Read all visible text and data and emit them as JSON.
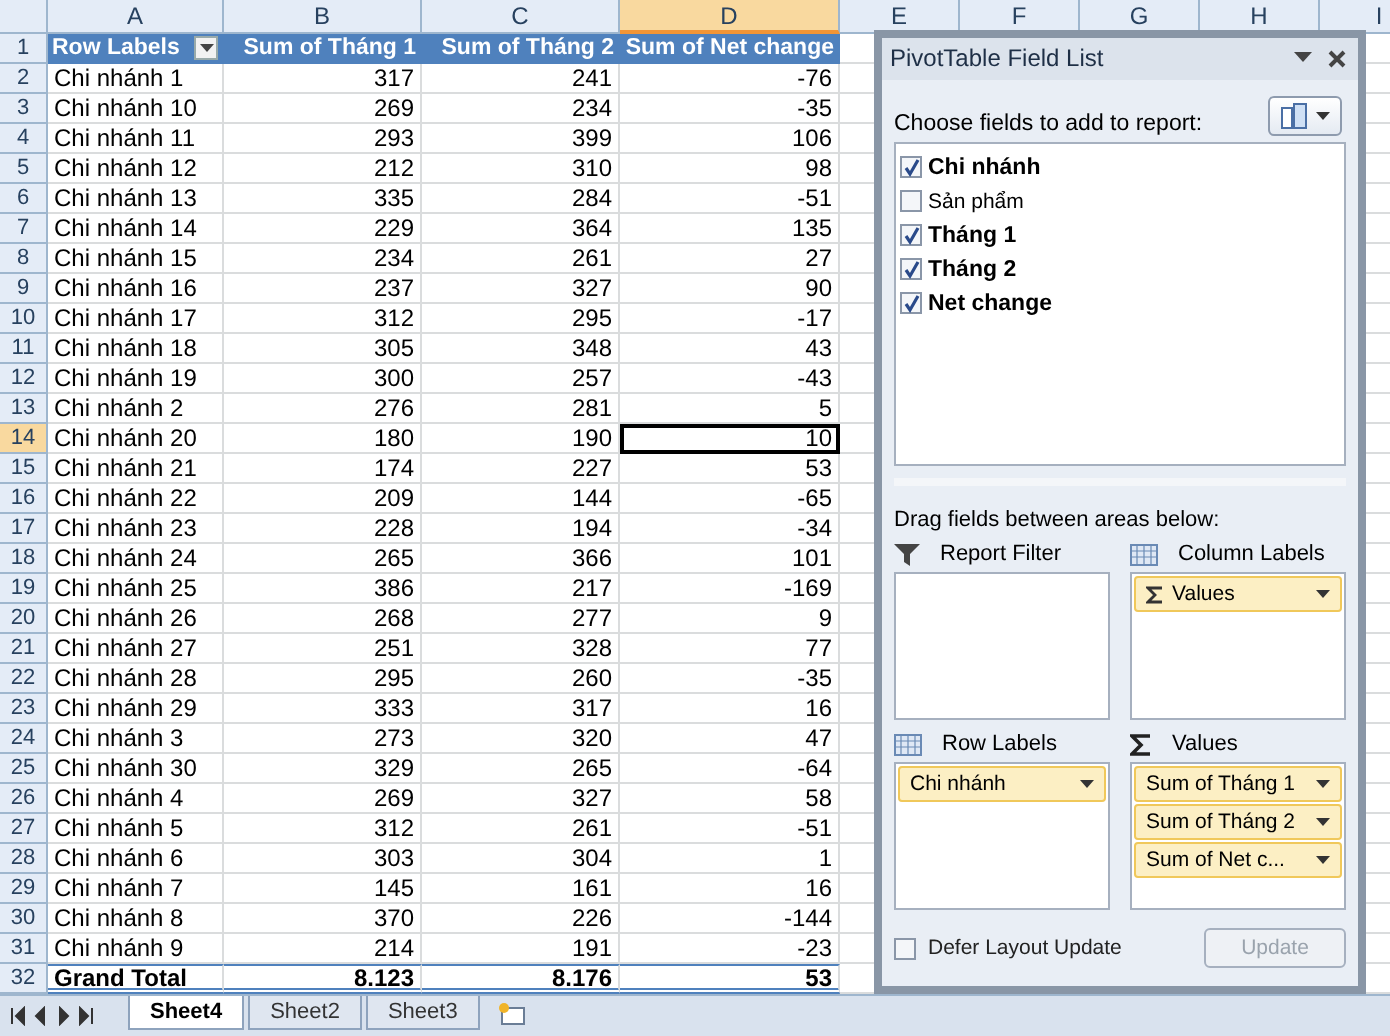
{
  "columns": [
    {
      "label": "A",
      "selected": false
    },
    {
      "label": "B",
      "selected": false
    },
    {
      "label": "C",
      "selected": false
    },
    {
      "label": "D",
      "selected": true
    },
    {
      "label": "E",
      "selected": false
    },
    {
      "label": "F",
      "selected": false
    },
    {
      "label": "G",
      "selected": false
    },
    {
      "label": "H",
      "selected": false
    },
    {
      "label": "I",
      "selected": false
    }
  ],
  "pivot": {
    "header_row": "1",
    "headers": [
      "Row Labels",
      "Sum of Tháng 1",
      "Sum of Tháng 2",
      "Sum of Net change"
    ],
    "rows": [
      {
        "n": "2",
        "label": "Chi nhánh 1",
        "values": [
          "317",
          "241",
          "-76"
        ],
        "selected": false
      },
      {
        "n": "3",
        "label": "Chi nhánh 10",
        "values": [
          "269",
          "234",
          "-35"
        ],
        "selected": false
      },
      {
        "n": "4",
        "label": "Chi nhánh 11",
        "values": [
          "293",
          "399",
          "106"
        ],
        "selected": false
      },
      {
        "n": "5",
        "label": "Chi nhánh 12",
        "values": [
          "212",
          "310",
          "98"
        ],
        "selected": false
      },
      {
        "n": "6",
        "label": "Chi nhánh 13",
        "values": [
          "335",
          "284",
          "-51"
        ],
        "selected": false
      },
      {
        "n": "7",
        "label": "Chi nhánh 14",
        "values": [
          "229",
          "364",
          "135"
        ],
        "selected": false
      },
      {
        "n": "8",
        "label": "Chi nhánh 15",
        "values": [
          "234",
          "261",
          "27"
        ],
        "selected": false
      },
      {
        "n": "9",
        "label": "Chi nhánh 16",
        "values": [
          "237",
          "327",
          "90"
        ],
        "selected": false
      },
      {
        "n": "10",
        "label": "Chi nhánh 17",
        "values": [
          "312",
          "295",
          "-17"
        ],
        "selected": false
      },
      {
        "n": "11",
        "label": "Chi nhánh 18",
        "values": [
          "305",
          "348",
          "43"
        ],
        "selected": false
      },
      {
        "n": "12",
        "label": "Chi nhánh 19",
        "values": [
          "300",
          "257",
          "-43"
        ],
        "selected": false
      },
      {
        "n": "13",
        "label": "Chi nhánh 2",
        "values": [
          "276",
          "281",
          "5"
        ],
        "selected": false
      },
      {
        "n": "14",
        "label": "Chi nhánh 20",
        "values": [
          "180",
          "190",
          "10"
        ],
        "selected": true
      },
      {
        "n": "15",
        "label": "Chi nhánh 21",
        "values": [
          "174",
          "227",
          "53"
        ],
        "selected": false
      },
      {
        "n": "16",
        "label": "Chi nhánh 22",
        "values": [
          "209",
          "144",
          "-65"
        ],
        "selected": false
      },
      {
        "n": "17",
        "label": "Chi nhánh 23",
        "values": [
          "228",
          "194",
          "-34"
        ],
        "selected": false
      },
      {
        "n": "18",
        "label": "Chi nhánh 24",
        "values": [
          "265",
          "366",
          "101"
        ],
        "selected": false
      },
      {
        "n": "19",
        "label": "Chi nhánh 25",
        "values": [
          "386",
          "217",
          "-169"
        ],
        "selected": false
      },
      {
        "n": "20",
        "label": "Chi nhánh 26",
        "values": [
          "268",
          "277",
          "9"
        ],
        "selected": false
      },
      {
        "n": "21",
        "label": "Chi nhánh 27",
        "values": [
          "251",
          "328",
          "77"
        ],
        "selected": false
      },
      {
        "n": "22",
        "label": "Chi nhánh 28",
        "values": [
          "295",
          "260",
          "-35"
        ],
        "selected": false
      },
      {
        "n": "23",
        "label": "Chi nhánh 29",
        "values": [
          "333",
          "317",
          "16"
        ],
        "selected": false
      },
      {
        "n": "24",
        "label": "Chi nhánh 3",
        "values": [
          "273",
          "320",
          "47"
        ],
        "selected": false
      },
      {
        "n": "25",
        "label": "Chi nhánh 30",
        "values": [
          "329",
          "265",
          "-64"
        ],
        "selected": false
      },
      {
        "n": "26",
        "label": "Chi nhánh 4",
        "values": [
          "269",
          "327",
          "58"
        ],
        "selected": false
      },
      {
        "n": "27",
        "label": "Chi nhánh 5",
        "values": [
          "312",
          "261",
          "-51"
        ],
        "selected": false
      },
      {
        "n": "28",
        "label": "Chi nhánh 6",
        "values": [
          "303",
          "304",
          "1"
        ],
        "selected": false
      },
      {
        "n": "29",
        "label": "Chi nhánh 7",
        "values": [
          "145",
          "161",
          "16"
        ],
        "selected": false
      },
      {
        "n": "30",
        "label": "Chi nhánh 8",
        "values": [
          "370",
          "226",
          "-144"
        ],
        "selected": false
      },
      {
        "n": "31",
        "label": "Chi nhánh 9",
        "values": [
          "214",
          "191",
          "-23"
        ],
        "selected": false
      }
    ],
    "total": {
      "n": "32",
      "label": "Grand Total",
      "values": [
        "8.123",
        "8.176",
        "53"
      ]
    }
  },
  "field_list": {
    "title": "PivotTable Field List",
    "choose_label": "Choose fields to add to report:",
    "fields": [
      {
        "label": "Chi nhánh",
        "checked": true
      },
      {
        "label": "Sản phẩm",
        "checked": false
      },
      {
        "label": "Tháng 1",
        "checked": true
      },
      {
        "label": "Tháng 2",
        "checked": true
      },
      {
        "label": "Net change",
        "checked": true
      }
    ],
    "drag_label": "Drag fields between areas below:",
    "areas": [
      {
        "kind": "filter",
        "label": "Report Filter"
      },
      {
        "kind": "columns",
        "label": "Column Labels",
        "items": [
          "Values"
        ]
      },
      {
        "kind": "rows",
        "label": "Row Labels",
        "items": [
          "Chi nhánh"
        ]
      },
      {
        "kind": "values",
        "label": "Values",
        "items": [
          "Sum of Tháng 1",
          "Sum of Tháng 2",
          "Sum of Net c..."
        ]
      }
    ],
    "defer": {
      "label": "Defer Layout Update",
      "checked": false
    },
    "update": {
      "label": "Update",
      "disabled": true
    }
  },
  "sheet_tabs": [
    {
      "label": "Sheet4",
      "selected": true
    },
    {
      "label": "Sheet2",
      "selected": false
    },
    {
      "label": "Sheet3",
      "selected": false
    }
  ]
}
